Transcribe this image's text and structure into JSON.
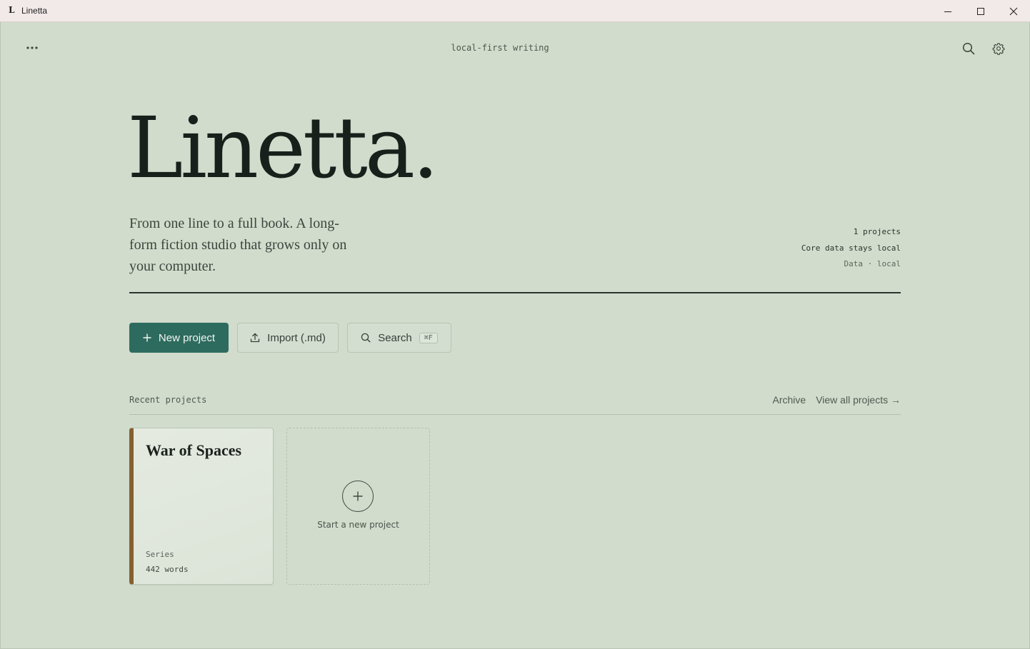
{
  "window": {
    "logo": "L",
    "title": "Linetta"
  },
  "topbar": {
    "menu_icon": "more-horizontal-icon",
    "tagline": "local-first writing",
    "search_icon": "search-icon",
    "settings_icon": "gear-icon"
  },
  "hero": {
    "title": "Linetta.",
    "description": "From one line to a full book. A long-form fiction studio that grows only on your computer."
  },
  "stats": {
    "projects": "1 projects",
    "storage": "Core data stays local",
    "data": "Data · local"
  },
  "actions": {
    "new_project": "New project",
    "new_project_icon": "plus-icon",
    "import": "Import (.md)",
    "import_icon": "upload-icon",
    "search": "Search",
    "search_icon": "search-icon",
    "search_shortcut": "⌘F"
  },
  "recent": {
    "label": "Recent projects",
    "archive_link": "Archive",
    "view_all_link": "View all projects →",
    "projects": [
      {
        "title": "War of Spaces",
        "type": "Series",
        "words": "442 words",
        "accent_color": "#86602f"
      }
    ],
    "new_card_label": "Start a new project",
    "new_card_icon": "plus-icon"
  },
  "colors": {
    "background": "#d1dccc",
    "primary": "#2e6b5f",
    "title_bar": "#f2e9e9"
  }
}
